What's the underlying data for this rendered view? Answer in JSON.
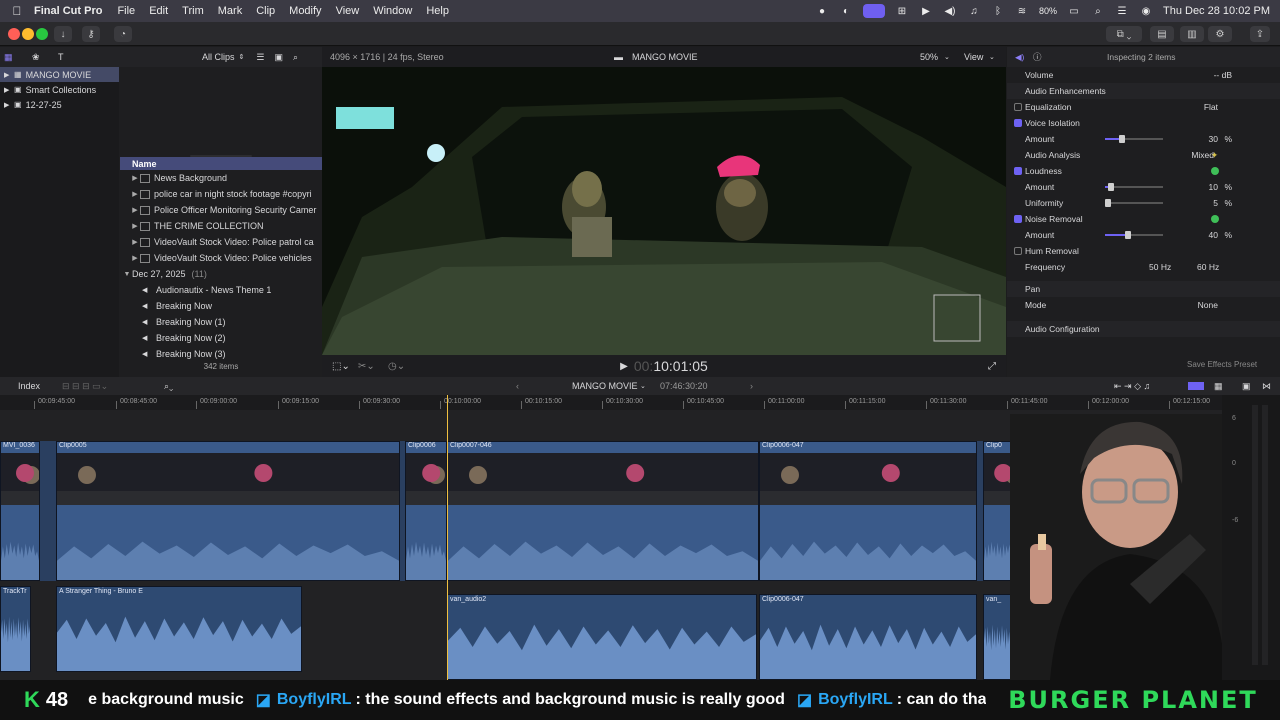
{
  "menubar": {
    "app_name": "Final Cut Pro",
    "menus": [
      "File",
      "Edit",
      "Trim",
      "Mark",
      "Clip",
      "Modify",
      "View",
      "Window",
      "Help"
    ],
    "battery": "80%",
    "datetime": "Thu Dec 28  10:02 PM"
  },
  "browser": {
    "filter": "All Clips",
    "libraries": [
      {
        "label": "MANGO MOVIE",
        "selected": true
      },
      {
        "label": "Smart Collections",
        "selected": false
      },
      {
        "label": "12-27-25",
        "selected": false
      }
    ],
    "column_name": "Name",
    "rows": [
      {
        "label": "News Background",
        "type": "clip"
      },
      {
        "label": "police  car in night stock footage #copyri",
        "type": "clip"
      },
      {
        "label": "Police Officer Monitoring Security Camer",
        "type": "clip"
      },
      {
        "label": "THE CRIME COLLECTION",
        "type": "clip"
      },
      {
        "label": "VideoVault Stock Video:  Police patrol ca",
        "type": "clip"
      },
      {
        "label": "VideoVault Stock Video:  Police vehicles",
        "type": "clip"
      }
    ],
    "date_group": {
      "label": "Dec 27, 2025",
      "count": "(11)"
    },
    "audio_rows": [
      "Audionautix - News Theme 1",
      "Breaking Now",
      "Breaking Now (1)",
      "Breaking Now (2)",
      "Breaking Now (3)"
    ],
    "item_count": "342 items"
  },
  "viewer": {
    "format": "4096 × 1716 | 24 fps, Stereo",
    "project": "MANGO MOVIE",
    "zoom": "50%",
    "view_label": "View",
    "timecode_dim": "00:",
    "timecode": "10:01:05"
  },
  "inspector": {
    "title": "Inspecting 2 items",
    "volume_label": "Volume",
    "volume_value": "-- dB",
    "enhancements_label": "Audio Enhancements",
    "rows": [
      {
        "label": "Equalization",
        "value": "Flat",
        "checked": false,
        "kind": "check"
      },
      {
        "label": "Voice Isolation",
        "checked": true,
        "kind": "check"
      },
      {
        "label": "Amount",
        "value": "30",
        "unit": "%",
        "slider": 0.3,
        "kind": "slider"
      },
      {
        "label": "Audio Analysis",
        "value": "Mixed",
        "kind": "info"
      },
      {
        "label": "Loudness",
        "checked": true,
        "ok": true,
        "kind": "check"
      },
      {
        "label": "Amount",
        "value": "10",
        "unit": "%",
        "slider": 0.1,
        "kind": "slider"
      },
      {
        "label": "Uniformity",
        "value": "5",
        "unit": "%",
        "slider": 0.05,
        "kind": "slider"
      },
      {
        "label": "Noise Removal",
        "checked": true,
        "ok": true,
        "kind": "check"
      },
      {
        "label": "Amount",
        "value": "40",
        "unit": "%",
        "slider": 0.4,
        "kind": "slider"
      },
      {
        "label": "Hum Removal",
        "checked": false,
        "kind": "check"
      },
      {
        "label": "Frequency",
        "value": "50 Hz",
        "value2": "60 Hz",
        "kind": "freq"
      }
    ],
    "pan_label": "Pan",
    "mode_label": "Mode",
    "mode_value": "None",
    "config_label": "Audio Configuration",
    "save_preset": "Save Effects Preset"
  },
  "timeline": {
    "index_label": "Index",
    "project": "MANGO MOVIE",
    "duration": "07:46:30:20",
    "ruler": [
      "00:09:45:00",
      "00:10:00:00",
      "00:10:15:00",
      "00:10:30:00",
      "00:10:45:00",
      "00:11:00:00",
      "00:11:15:00",
      "00:11:30:00",
      "00:11:45:00",
      "00:12:00:00",
      "00:12:15:00",
      "00:08:45:00",
      "00:09:00:00",
      "00:09:15:00",
      "00:09:30:00"
    ],
    "video_clips": [
      {
        "name": "MVI_0036"
      },
      {
        "name": "Clip0005"
      },
      {
        "name": "Clip0006"
      },
      {
        "name": "Clip0007-046"
      },
      {
        "name": "Clip0006-047"
      },
      {
        "name": "Clip0"
      },
      {
        "name": "Clip0007-046"
      },
      {
        "name": "Clip0006-0"
      }
    ],
    "audio_clips": [
      {
        "name": "TrackTr"
      },
      {
        "name": "A Stranger Thing - Bruno E"
      },
      {
        "name": "van_audio2"
      },
      {
        "name": "Clip0006-047"
      },
      {
        "name": "van_"
      }
    ],
    "meter_ticks": [
      "6",
      "0",
      "-6"
    ]
  },
  "stream": {
    "viewers": "48",
    "ticker_1": "e background music",
    "user_1": "BoyflyIRL",
    "msg_1": ": the sound effects and background music is really good",
    "user_2": "BoyflyIRL",
    "msg_2": ": can do that",
    "brand": "BURGER PLANET"
  },
  "colors": {
    "accent": "#6e62f3",
    "clip_blue": "#3a5a8a",
    "playhead": "#f0c040",
    "ok": "#3fbf58",
    "brand_green": "#2fd95a"
  }
}
